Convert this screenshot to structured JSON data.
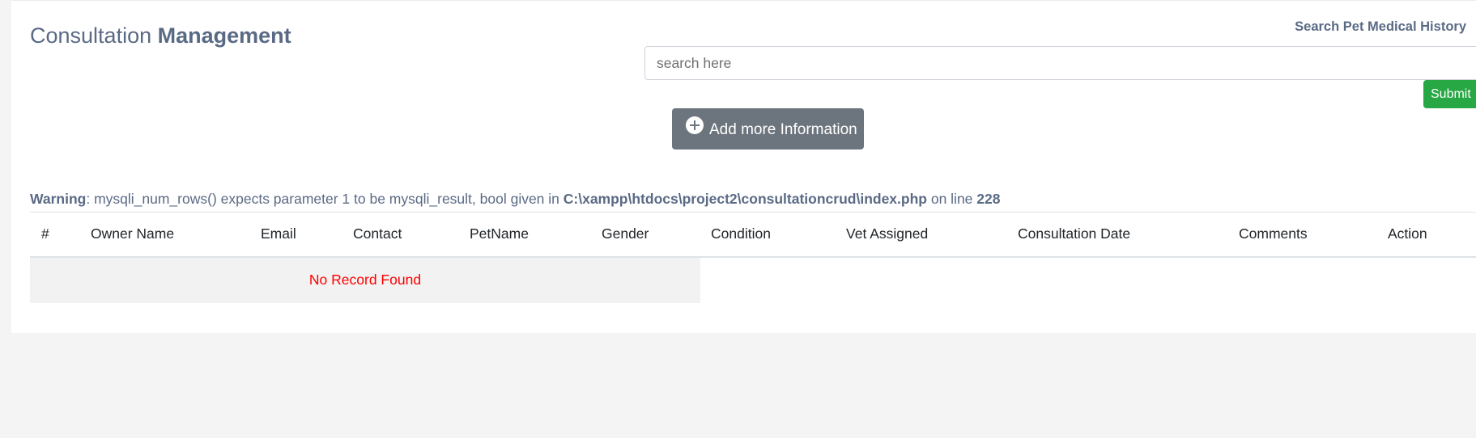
{
  "header": {
    "title_light": "Consultation ",
    "title_bold": "Management"
  },
  "search": {
    "heading": "Search Pet Medical History",
    "placeholder": "search here",
    "value": "",
    "submit_label": "Submit"
  },
  "actions": {
    "add_icon": "plus-circle-icon",
    "add_label": "Add more Information"
  },
  "warning": {
    "level": "Warning",
    "message": ": mysqli_num_rows() expects parameter 1 to be mysqli_result, bool given in ",
    "file": "C:\\xampp\\htdocs\\project2\\consultationcrud\\index.php",
    "line_prefix": " on line ",
    "line": "228"
  },
  "table": {
    "columns": [
      "#",
      "Owner Name",
      "Email",
      "Contact",
      "PetName",
      "Gender",
      "Condition",
      "Vet Assigned",
      "Consultation Date",
      "Comments",
      "Action"
    ],
    "empty_message": "No Record Found"
  },
  "colors": {
    "text_primary": "#5a6a85",
    "submit_bg": "#28a745",
    "add_button_bg": "#6c757d",
    "empty_text": "#ff0000",
    "page_bg": "#f4f4f4"
  }
}
